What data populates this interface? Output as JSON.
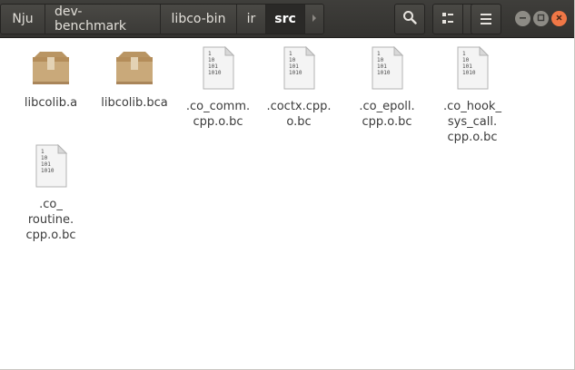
{
  "breadcrumbs": [
    {
      "label": "Nju"
    },
    {
      "label": "dev-benchmark"
    },
    {
      "label": "libco-bin"
    },
    {
      "label": "ir"
    },
    {
      "label": "src"
    }
  ],
  "toolbar": {
    "search_icon": "search-icon",
    "view_icon": "grid-view-icon",
    "menu_icon": "hamburger-menu-icon"
  },
  "files": [
    {
      "name": "libcolib.a",
      "icon": "package-icon"
    },
    {
      "name": "libcolib.bca",
      "icon": "package-icon"
    },
    {
      "name": ".co_comm.\ncpp.o.bc",
      "icon": "binary-file-icon"
    },
    {
      "name": ".coctx.cpp.\no.bc",
      "icon": "binary-file-icon"
    },
    {
      "name": ".co_epoll.\ncpp.o.bc",
      "icon": "binary-file-icon"
    },
    {
      "name": ".co_hook_\nsys_call.\ncpp.o.bc",
      "icon": "binary-file-icon"
    },
    {
      "name": ".co_\nroutine.\ncpp.o.bc",
      "icon": "binary-file-icon"
    }
  ],
  "binary_icon_text": [
    "1",
    "10",
    "101",
    "1010"
  ],
  "colors": {
    "header": "#3c3b37",
    "package": "#c9a97a",
    "close": "#f07746",
    "inactive_btn": "#8d8b85"
  }
}
